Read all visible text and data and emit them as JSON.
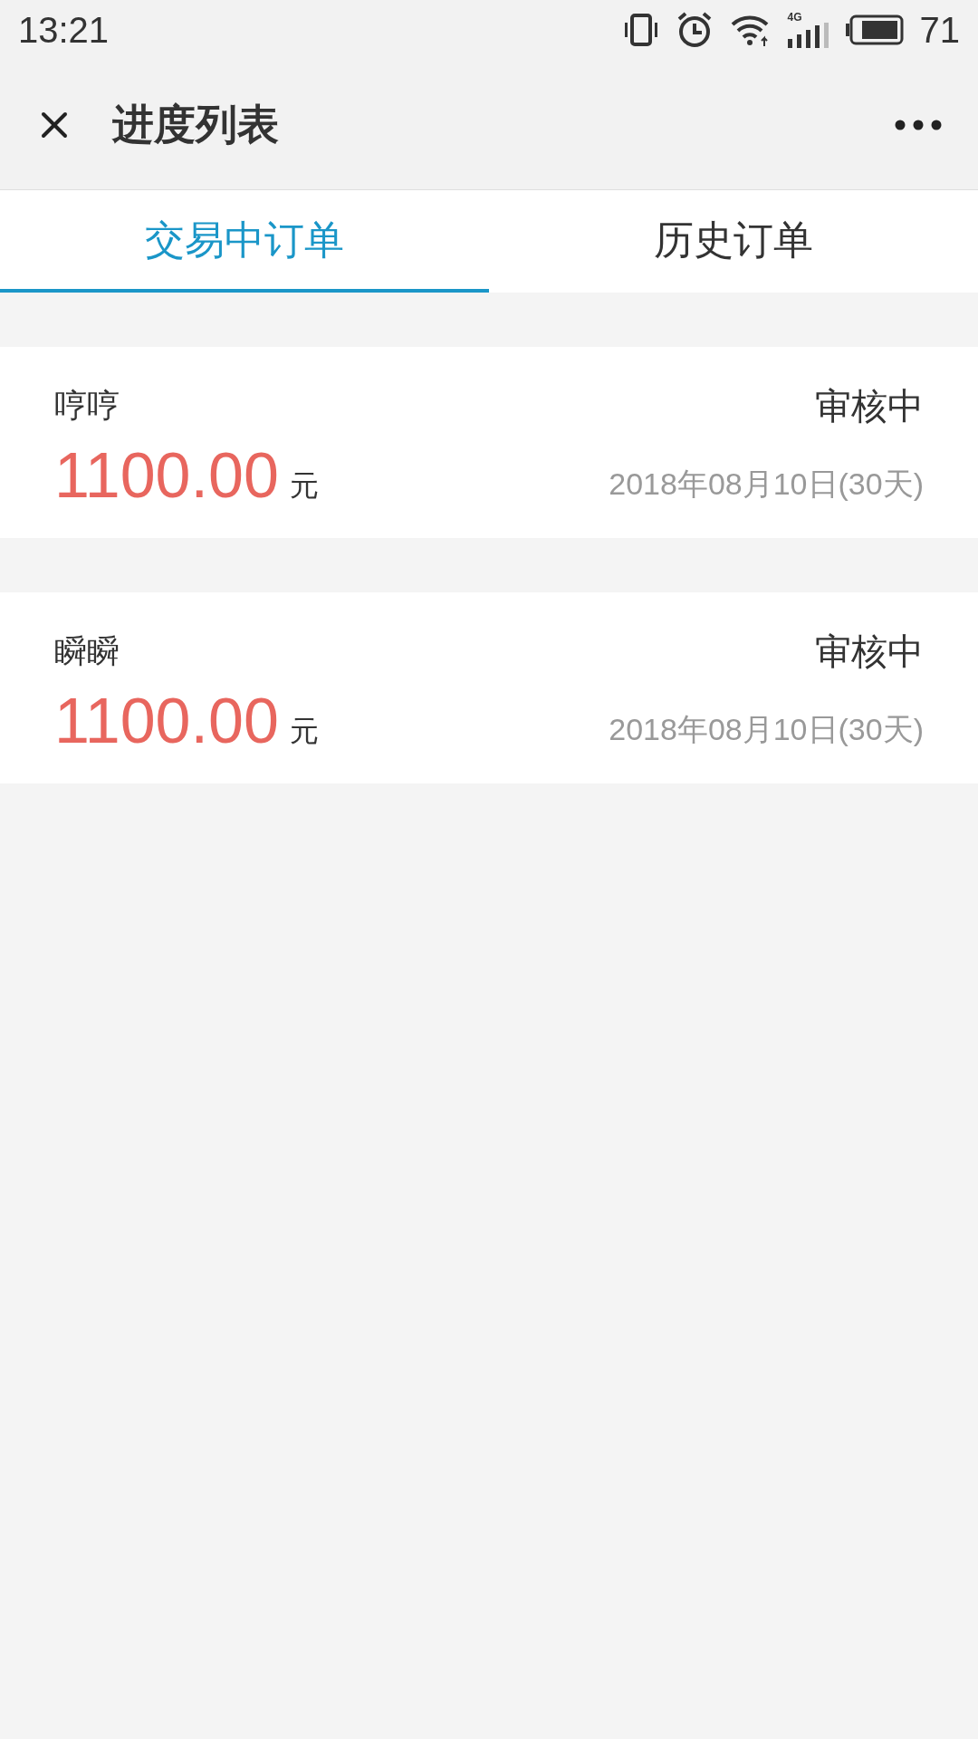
{
  "status_bar": {
    "time": "13:21",
    "network": "4G",
    "battery": "71"
  },
  "header": {
    "title": "进度列表"
  },
  "tabs": [
    {
      "label": "交易中订单",
      "selected": true
    },
    {
      "label": "历史订单",
      "selected": false
    }
  ],
  "orders": [
    {
      "name": "哼哼",
      "status": "审核中",
      "amount": "1100.00",
      "unit": "元",
      "date": "2018年08月10日(30天)"
    },
    {
      "name": "瞬瞬",
      "status": "审核中",
      "amount": "1100.00",
      "unit": "元",
      "date": "2018年08月10日(30天)"
    }
  ]
}
